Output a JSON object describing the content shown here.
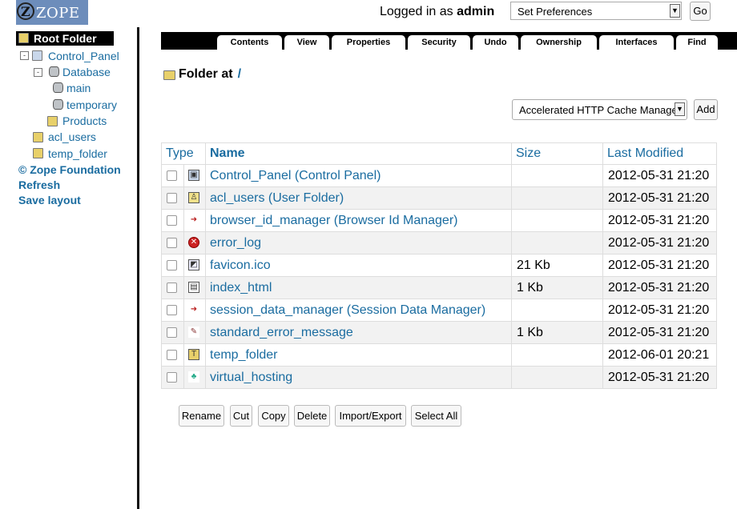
{
  "header": {
    "logo_text": "ZOPE",
    "logo_mark": "Z",
    "logged_in_prefix": "Logged in as",
    "logged_in_user": "admin",
    "preferences_select": "Set Preferences",
    "go_label": "Go"
  },
  "nav": {
    "root": "Root Folder",
    "tree": [
      {
        "label": "Control_Panel",
        "icon": "control-panel-icon",
        "toggle": "-"
      },
      {
        "label": "Database",
        "icon": "database-icon",
        "toggle": "-"
      },
      {
        "label": "main",
        "icon": "database-icon"
      },
      {
        "label": "temporary",
        "icon": "database-icon"
      },
      {
        "label": "Products",
        "icon": "folder-icon"
      },
      {
        "label": "acl_users",
        "icon": "user-folder-icon"
      },
      {
        "label": "temp_folder",
        "icon": "temp-folder-icon"
      }
    ],
    "links": [
      "© Zope Foundation",
      "Refresh",
      "Save layout"
    ]
  },
  "tabs": [
    "Contents",
    "View",
    "Properties",
    "Security",
    "Undo",
    "Ownership",
    "Interfaces",
    "Find"
  ],
  "heading": {
    "prefix": "Folder at",
    "path": "/"
  },
  "add": {
    "select_value": "Accelerated HTTP Cache Manager",
    "button": "Add"
  },
  "table": {
    "columns": [
      "Type",
      "Name",
      "Size",
      "Last Modified"
    ],
    "rows": [
      {
        "name": "Control_Panel (Control Panel)",
        "size": "",
        "modified": "2012-05-31 21:20",
        "icon": "control-panel-icon"
      },
      {
        "name": "acl_users (User Folder)",
        "size": "",
        "modified": "2012-05-31 21:20",
        "icon": "user-folder-icon"
      },
      {
        "name": "browser_id_manager (Browser Id Manager)",
        "size": "",
        "modified": "2012-05-31 21:20",
        "icon": "browser-id-icon"
      },
      {
        "name": "error_log",
        "size": "",
        "modified": "2012-05-31 21:20",
        "icon": "error-log-icon"
      },
      {
        "name": "favicon.ico",
        "size": "21 Kb",
        "modified": "2012-05-31 21:20",
        "icon": "image-icon"
      },
      {
        "name": "index_html",
        "size": "1 Kb",
        "modified": "2012-05-31 21:20",
        "icon": "page-template-icon"
      },
      {
        "name": "session_data_manager (Session Data Manager)",
        "size": "",
        "modified": "2012-05-31 21:20",
        "icon": "session-manager-icon"
      },
      {
        "name": "standard_error_message",
        "size": "1 Kb",
        "modified": "2012-05-31 21:20",
        "icon": "dtml-method-icon"
      },
      {
        "name": "temp_folder",
        "size": "",
        "modified": "2012-06-01 20:21",
        "icon": "temp-folder-icon"
      },
      {
        "name": "virtual_hosting",
        "size": "",
        "modified": "2012-05-31 21:20",
        "icon": "virtual-host-icon"
      }
    ]
  },
  "actions": [
    "Rename",
    "Cut",
    "Copy",
    "Delete",
    "Import/Export",
    "Select All"
  ],
  "colors": {
    "link": "#1a6ca0",
    "logo_bg": "#6d8dbb",
    "tab_bar": "#000000",
    "row_alt": "#f2f2f2"
  }
}
